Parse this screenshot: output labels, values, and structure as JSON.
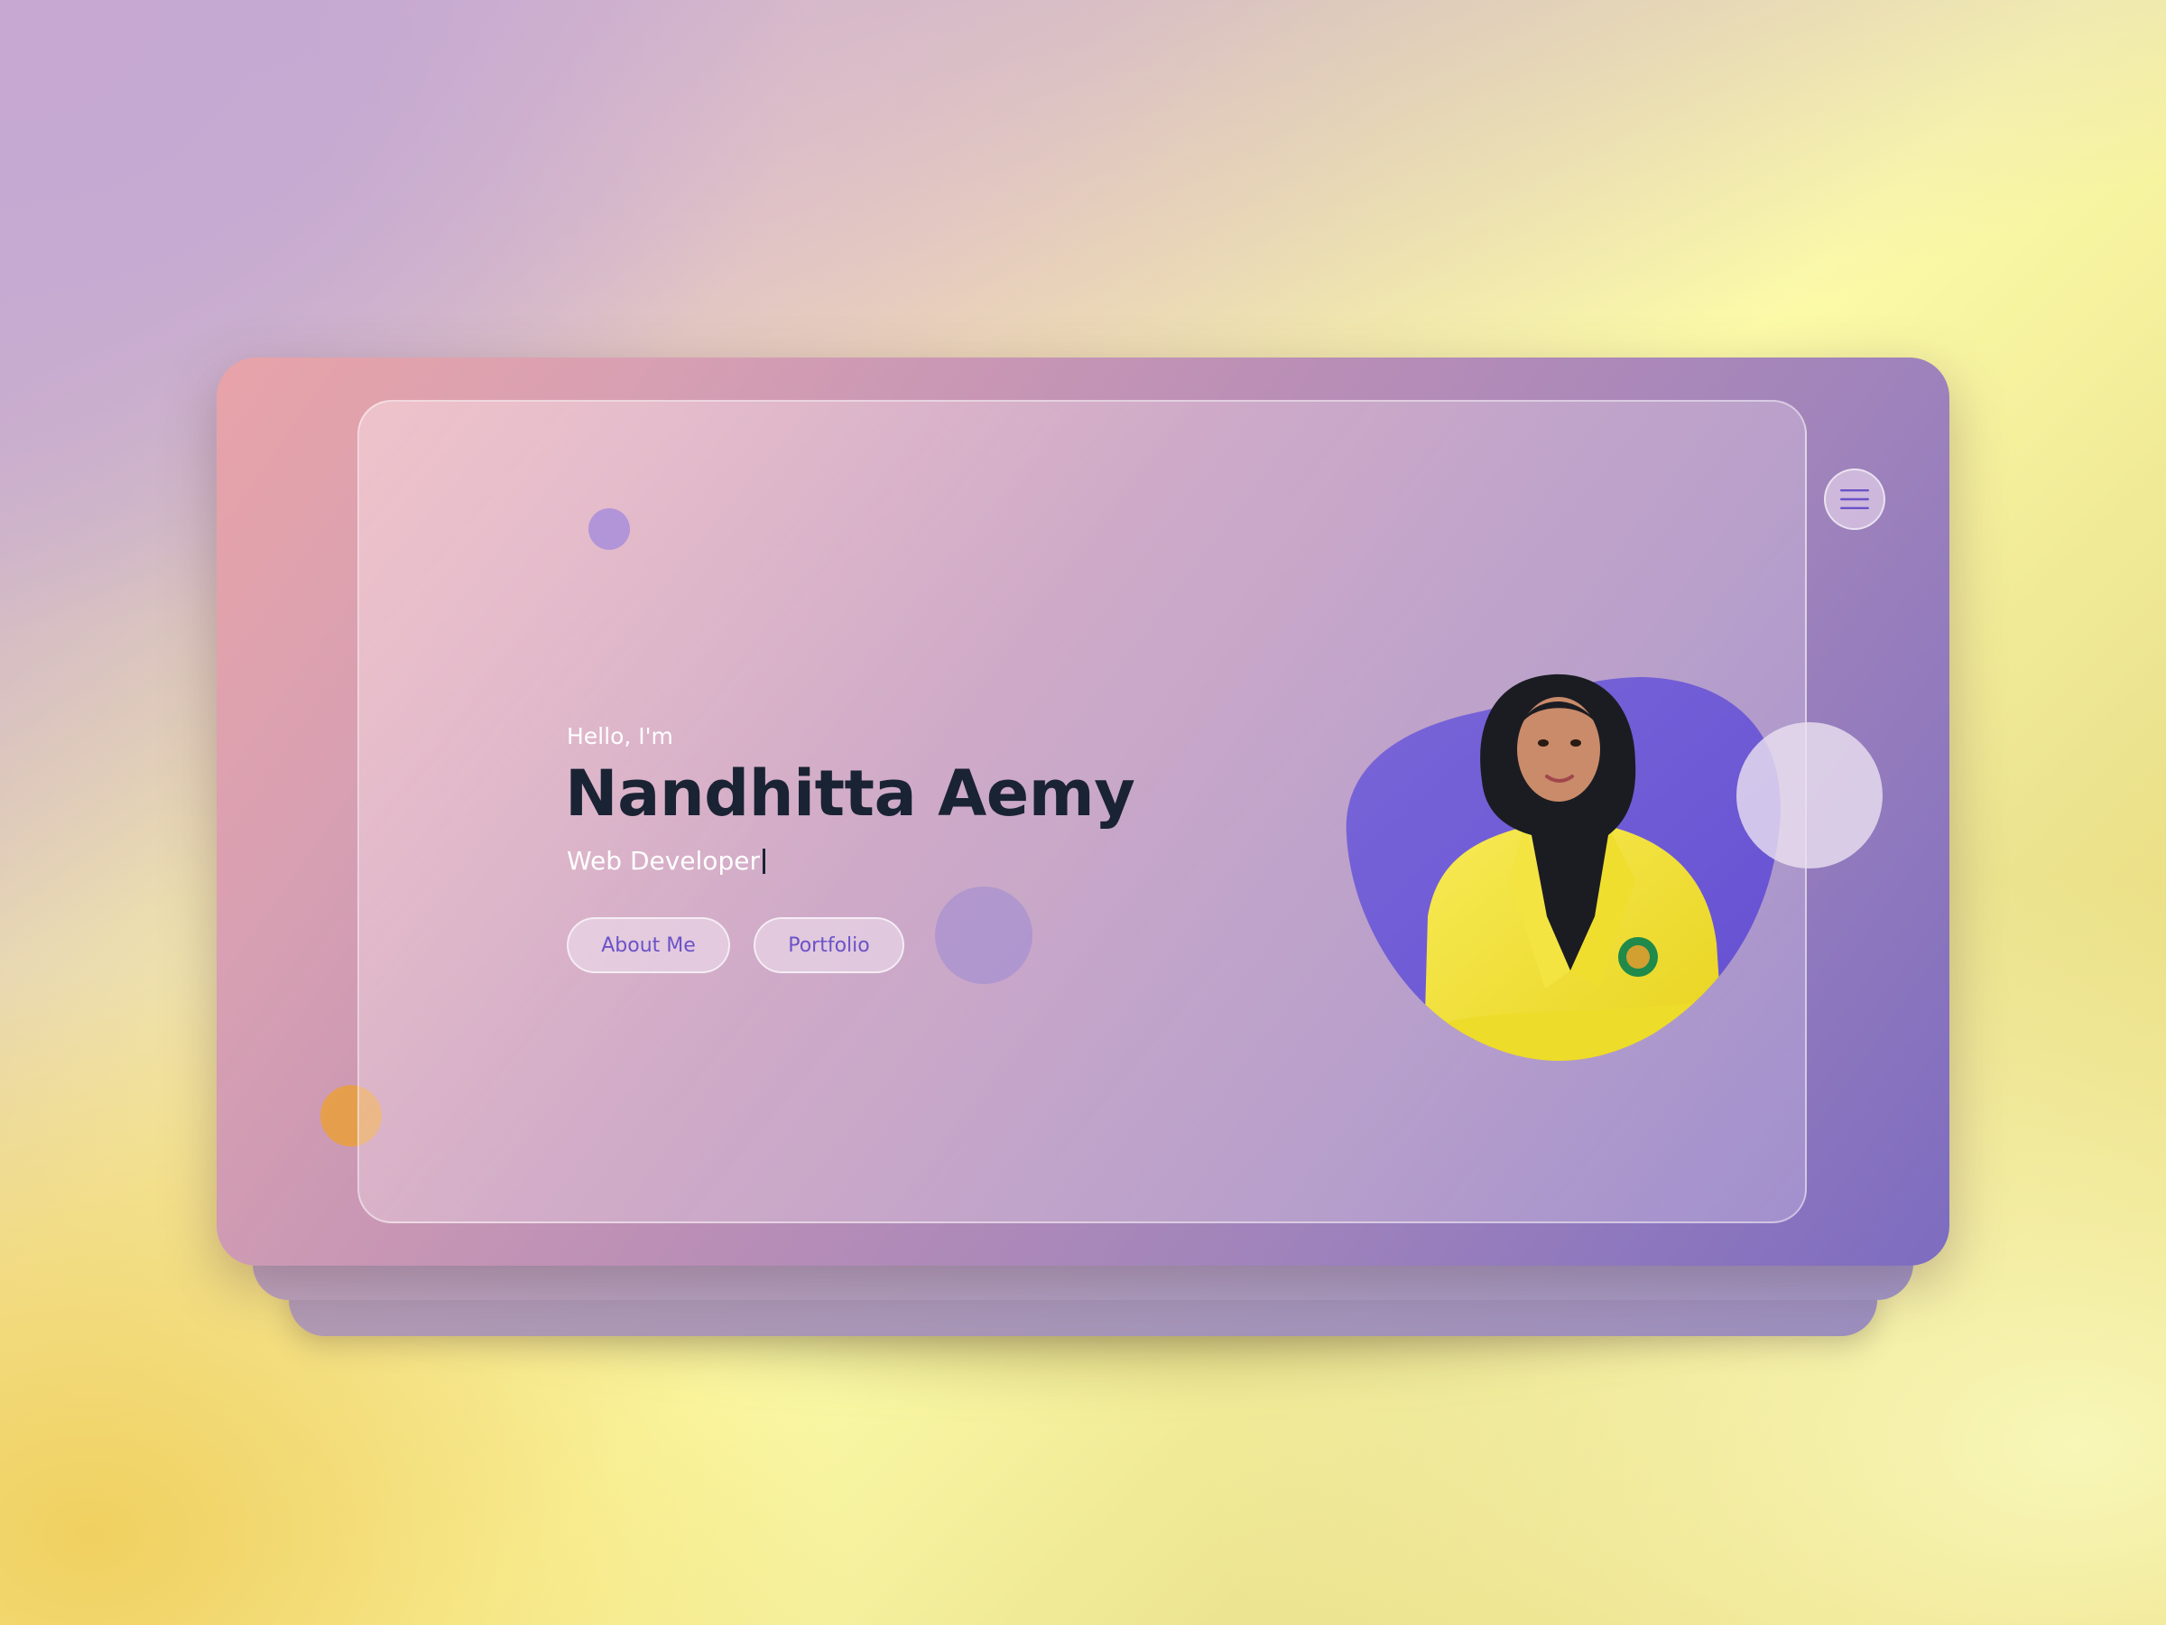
{
  "hero": {
    "greeting": "Hello, I'm",
    "name": "Nandhitta Aemy",
    "role": "Web Developer"
  },
  "buttons": {
    "about": "About Me",
    "portfolio": "Portfolio"
  },
  "icons": {
    "menu": "hamburger-menu-icon",
    "logo": "logo-dot"
  },
  "colors": {
    "accent": "#6a52c8",
    "blob": "#6e5ad6",
    "name_text": "#1a2333",
    "orange_dot": "#e8a040",
    "jacket": "#f2e030"
  }
}
